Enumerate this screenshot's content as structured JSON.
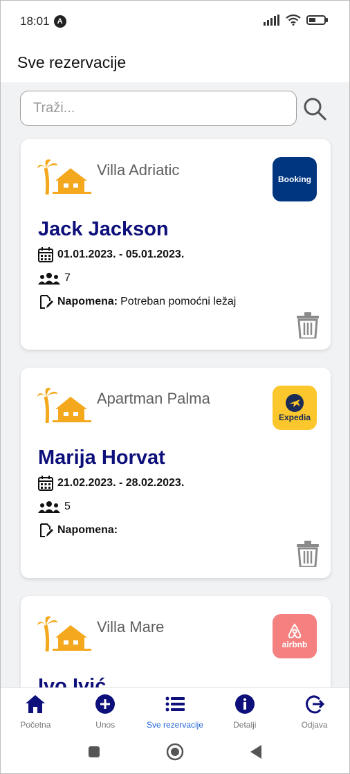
{
  "status_bar": {
    "time": "18:01",
    "badge": "A"
  },
  "header": {
    "title": "Sve rezervacije"
  },
  "search": {
    "placeholder": "Traži...",
    "value": ""
  },
  "reservations": [
    {
      "property": "Villa Adriatic",
      "source": "Booking",
      "guest": "Jack Jackson",
      "dates": "01.01.2023. - 05.01.2023.",
      "guests_count": "7",
      "note_label": "Napomena:",
      "note": "Potreban pomoćni ležaj"
    },
    {
      "property": "Apartman Palma",
      "source": "Expedia",
      "guest": "Marija Horvat",
      "dates": "21.02.2023. - 28.02.2023.",
      "guests_count": "5",
      "note_label": "Napomena:",
      "note": ""
    },
    {
      "property": "Villa Mare",
      "source": "airbnb",
      "guest": "Ivo Ivić"
    }
  ],
  "bottom_nav": [
    {
      "label": "Početna",
      "icon": "home-icon"
    },
    {
      "label": "Unos",
      "icon": "add-circle-icon"
    },
    {
      "label": "Sve rezervacije",
      "icon": "list-icon",
      "active": true
    },
    {
      "label": "Detalji",
      "icon": "info-icon"
    },
    {
      "label": "Odjava",
      "icon": "logout-icon"
    }
  ],
  "colors": {
    "primary": "#0d0f7a",
    "accent": "#f4a81d",
    "active_nav": "#1e63d6",
    "booking": "#003580",
    "expedia": "#fcc72c",
    "airbnb": "#f4807f"
  }
}
